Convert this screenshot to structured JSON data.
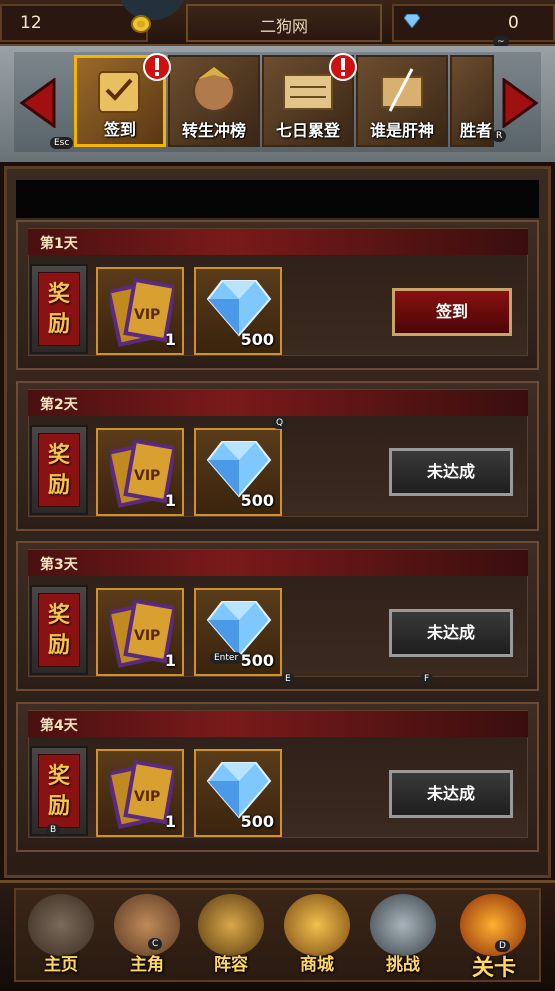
{
  "topbar": {
    "level": "12",
    "player_name": "二狗网",
    "gems": "0",
    "key_hint_top": "~"
  },
  "tabs": [
    {
      "label": "签到",
      "active": true,
      "alert": true
    },
    {
      "label": "转生冲榜",
      "active": false,
      "alert": false
    },
    {
      "label": "七日累登",
      "active": false,
      "alert": true
    },
    {
      "label": "谁是肝神",
      "active": false,
      "alert": false
    },
    {
      "label": "胜者",
      "active": false,
      "alert": false
    }
  ],
  "tab_hints": {
    "left": "Esc",
    "right": "R"
  },
  "days": [
    {
      "label": "第1天",
      "reward_text_1": "奖",
      "reward_text_2": "励",
      "vip_qty": "1",
      "gem_qty": "500",
      "button": "签到",
      "claimable": true
    },
    {
      "label": "第2天",
      "reward_text_1": "奖",
      "reward_text_2": "励",
      "vip_qty": "1",
      "gem_qty": "500",
      "button": "未达成",
      "claimable": false
    },
    {
      "label": "第3天",
      "reward_text_1": "奖",
      "reward_text_2": "励",
      "vip_qty": "1",
      "gem_qty": "500",
      "button": "未达成",
      "claimable": false
    },
    {
      "label": "第4天",
      "reward_text_1": "奖",
      "reward_text_2": "励",
      "vip_qty": "1",
      "gem_qty": "500",
      "button": "未达成",
      "claimable": false
    }
  ],
  "key_hints": {
    "q": "Q",
    "enter": "Enter",
    "e": "E",
    "f": "F",
    "b": "B",
    "c": "C",
    "d": "D"
  },
  "nav": [
    {
      "label": "主页",
      "icon": "tower-icon"
    },
    {
      "label": "主角",
      "icon": "hero-icon"
    },
    {
      "label": "阵容",
      "icon": "helmet-icon"
    },
    {
      "label": "商城",
      "icon": "chest-icon"
    },
    {
      "label": "挑战",
      "icon": "axes-icon"
    },
    {
      "label": "关卡",
      "icon": "stage-icon"
    }
  ],
  "colors": {
    "accent": "#f4b400",
    "claim": "#8a1010",
    "disabled": "#2a2a2a",
    "day_bar": "#7a1a1a"
  }
}
